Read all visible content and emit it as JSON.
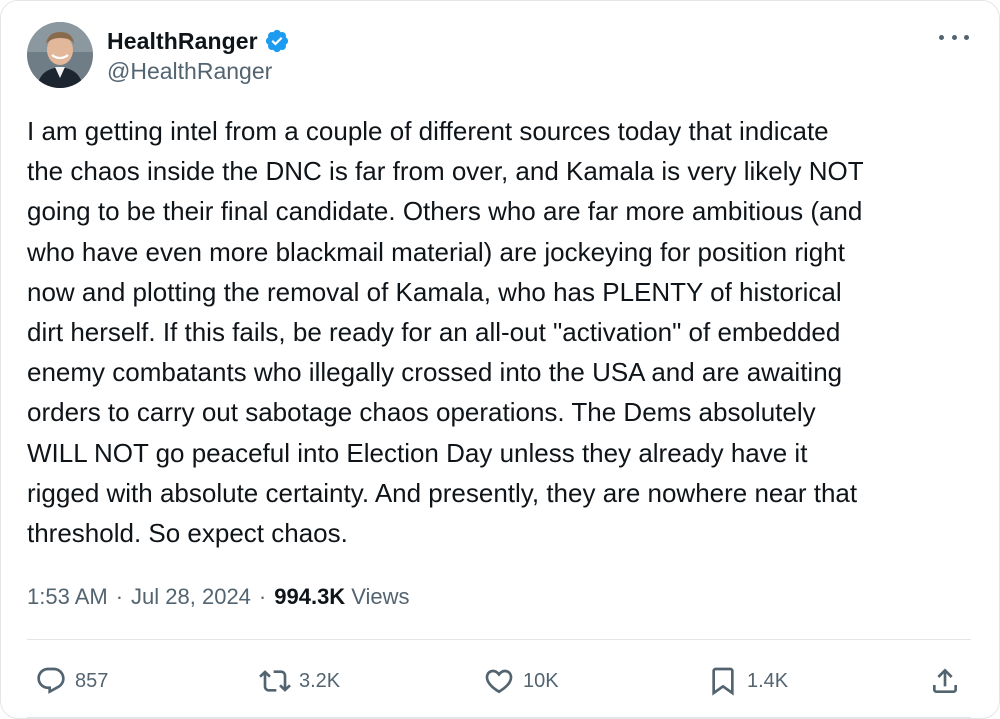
{
  "author": {
    "display_name": "HealthRanger",
    "handle": "@HealthRanger",
    "verified_icon": "verified-badge-icon",
    "badge_color": "#1d9bf0"
  },
  "tweet": {
    "text": "I am getting intel from a couple of different sources today that indicate\nthe chaos inside the DNC is far from over, and Kamala is very likely NOT\ngoing to be their final candidate. Others who are far more ambitious (and\nwho have even more blackmail material) are jockeying for position right\nnow and plotting the removal of Kamala, who has PLENTY of historical\ndirt herself. If this fails, be ready for an all-out \"activation\" of embedded\nenemy combatants who illegally crossed into the USA and are awaiting\norders to carry out sabotage chaos operations. The Dems absolutely\nWILL NOT go peaceful into Election Day unless they already have it\nrigged with absolute certainty. And presently, they are nowhere near that\nthreshold. So expect chaos.",
    "time": "1:53 AM",
    "separator": "·",
    "date": "Jul 28, 2024",
    "views_count": "994.3K",
    "views_label": "Views"
  },
  "actions": {
    "replies": {
      "icon": "reply-icon",
      "count": "857"
    },
    "reposts": {
      "icon": "repost-icon",
      "count": "3.2K"
    },
    "likes": {
      "icon": "heart-icon",
      "count": "10K"
    },
    "bookmarks": {
      "icon": "bookmark-icon",
      "count": "1.4K"
    },
    "share": {
      "icon": "share-icon"
    }
  },
  "menu": {
    "icon": "more-options-icon"
  },
  "colors": {
    "text_primary": "#0f1419",
    "text_secondary": "#536471",
    "border": "#e3e6e8",
    "accent": "#1d9bf0"
  }
}
